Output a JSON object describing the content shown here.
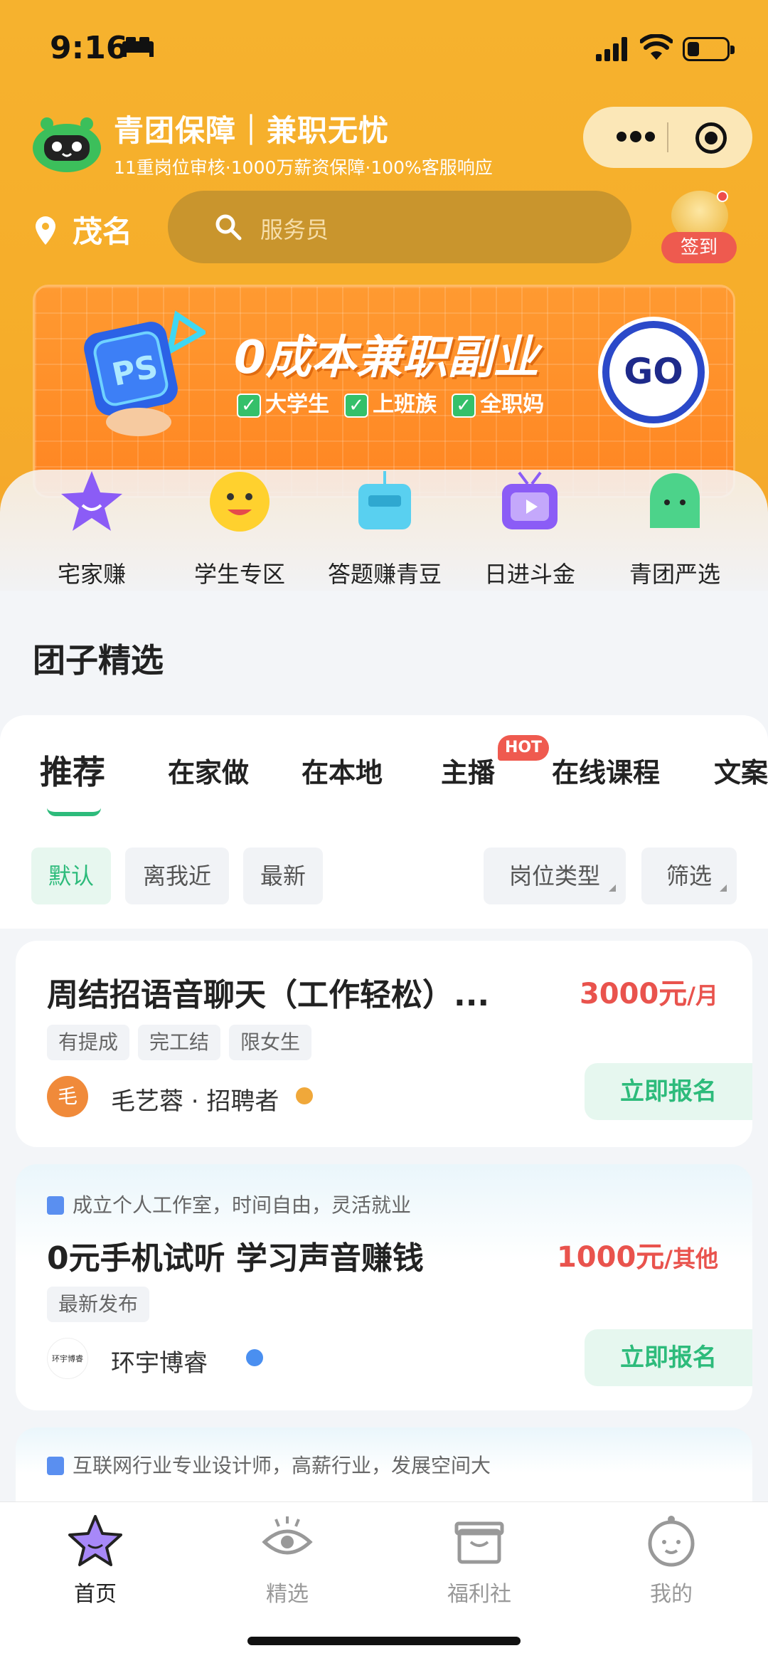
{
  "status_bar": {
    "time": "9:16"
  },
  "header": {
    "brand_title": "青团保障｜兼职无忧",
    "brand_subtitle": "11重岗位审核·1000万薪资保障·100%客服响应"
  },
  "location": {
    "city": "茂名"
  },
  "search": {
    "placeholder": "服务员"
  },
  "signin": {
    "label": "签到"
  },
  "banner": {
    "headline": "0成本兼职副业",
    "tags": [
      "大学生",
      "上班族",
      "全职妈"
    ],
    "go_label": "GO",
    "ps_label": "PS"
  },
  "categories": [
    {
      "label": "宅家赚",
      "icon": "purple-star-icon"
    },
    {
      "label": "学生专区",
      "icon": "smiley-face-icon"
    },
    {
      "label": "答题赚青豆",
      "icon": "tv-box-icon"
    },
    {
      "label": "日进斗金",
      "icon": "retro-tv-icon"
    },
    {
      "label": "青团严选",
      "icon": "green-mascot-icon"
    }
  ],
  "section": {
    "title": "团子精选"
  },
  "tabs": [
    "推荐",
    "在家做",
    "在本地",
    "主播",
    "在线课程",
    "文案"
  ],
  "hot_badge": "HOT",
  "filters": {
    "left": [
      "默认",
      "离我近",
      "最新"
    ],
    "right": [
      "岗位类型",
      "筛选"
    ]
  },
  "jobs": [
    {
      "title": "周结招语音聊天（工作轻松）...",
      "salary_amount": "3000元",
      "salary_unit": "/月",
      "tags": [
        "有提成",
        "完工结",
        "限女生"
      ],
      "recruiter": "毛艺蓉 · 招聘者",
      "avatar_text": "毛",
      "apply_label": "立即报名"
    },
    {
      "hint": "成立个人工作室，时间自由，灵活就业",
      "title": "0元手机试听 学习声音赚钱",
      "salary_amount": "1000元",
      "salary_unit": "/其他",
      "tags": [
        "最新发布"
      ],
      "recruiter": "环宇博睿",
      "avatar_text": "环宇博睿",
      "apply_label": "立即报名"
    },
    {
      "hint": "互联网行业专业设计师，高薪行业，发展空间大"
    }
  ],
  "tabbar": [
    {
      "label": "首页",
      "icon": "home-star-icon",
      "active": true
    },
    {
      "label": "精选",
      "icon": "eye-icon",
      "active": false
    },
    {
      "label": "福利社",
      "icon": "gift-box-icon",
      "active": false
    },
    {
      "label": "我的",
      "icon": "profile-face-icon",
      "active": false
    }
  ],
  "colors": {
    "brand_yellow": "#f6b22e",
    "accent_green": "#2dbb7b",
    "salary_red": "#e9534d",
    "search_bg": "#c9952d"
  }
}
